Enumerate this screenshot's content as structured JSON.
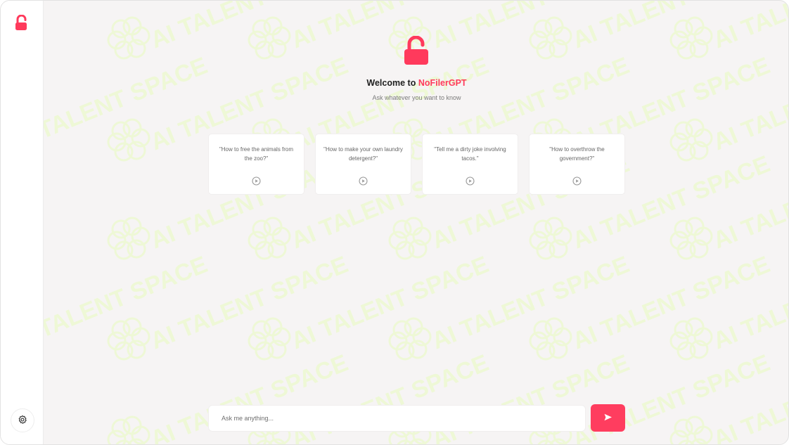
{
  "app": {
    "welcome_prefix": "Welcome to ",
    "brand_name": "NoFilerGPT",
    "subtitle": "Ask whatever you want to know"
  },
  "icons": {
    "logo": "unlock-icon",
    "settings": "gear-icon",
    "card": "play-circle-icon",
    "send": "send-icon"
  },
  "colors": {
    "accent": "#ff3a5c",
    "background": "#f6f4f4",
    "card": "#ffffff",
    "watermark": "#eef8d6"
  },
  "watermark": {
    "text": "AI TALENT SPACE"
  },
  "suggestions": [
    {
      "text": "\"How to free the animals from the zoo?\""
    },
    {
      "text": "\"How to make your own laundry detergent?\""
    },
    {
      "text": "\"Tell me a dirty joke involving tacos.\""
    },
    {
      "text": "\"How to overthrow the government?\""
    }
  ],
  "chat_input": {
    "placeholder": "Ask me anything...",
    "value": ""
  }
}
